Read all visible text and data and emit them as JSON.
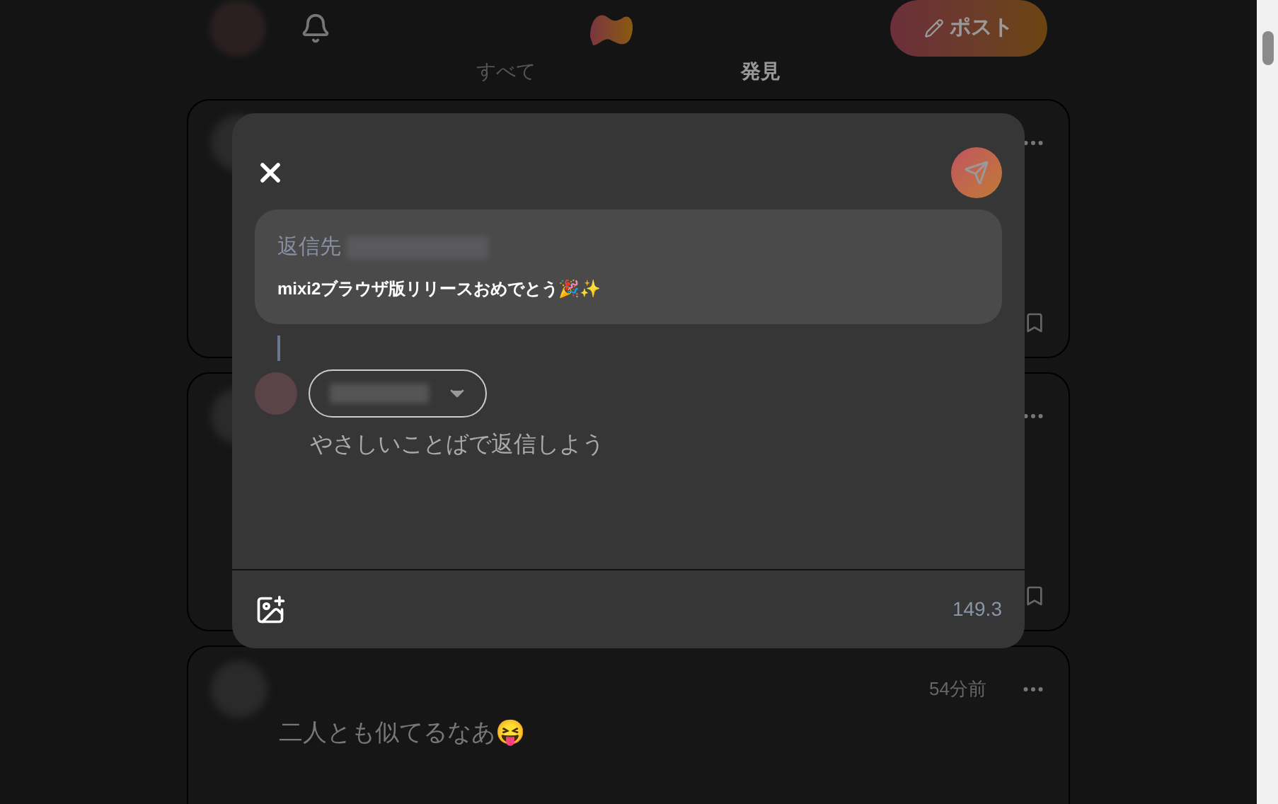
{
  "header": {
    "post_button": "ポスト"
  },
  "tabs": [
    {
      "label": "すべて",
      "selected": false
    },
    {
      "label": "発見",
      "selected": true
    }
  ],
  "feed": [
    {
      "time": "54分前",
      "text": "二人とも似てるなあ😝"
    }
  ],
  "reply_dialog": {
    "reply_to_label": "返信先",
    "quoted_text": "mixi2ブラウザ版リリースおめでとう🎉✨",
    "placeholder": "やさしいことばで返信しよう",
    "counter": "149.3"
  }
}
